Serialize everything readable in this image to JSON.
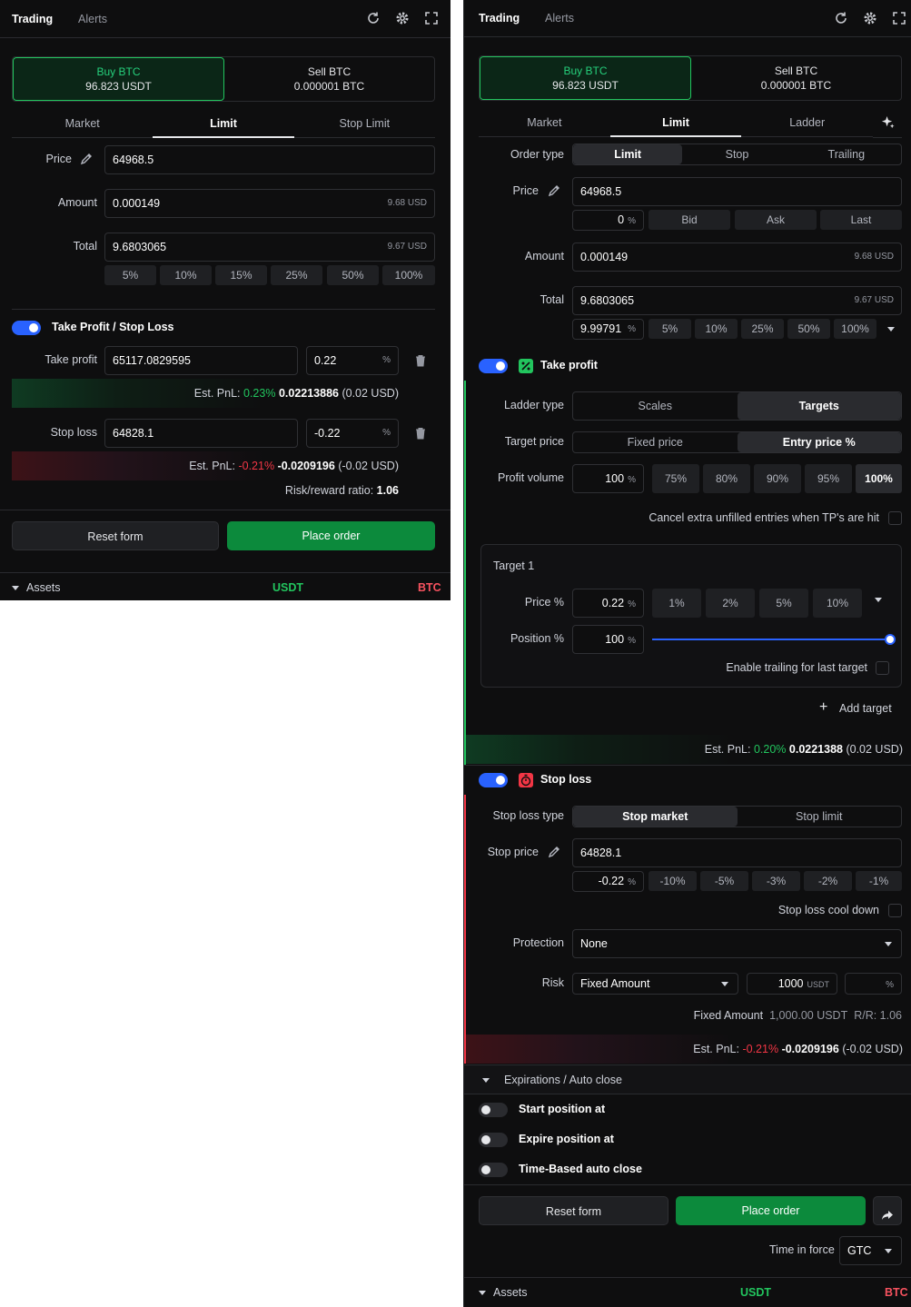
{
  "left": {
    "tabs": {
      "trading": "Trading",
      "alerts": "Alerts"
    },
    "buy": {
      "label": "Buy BTC",
      "value": "96.823 USDT"
    },
    "sell": {
      "label": "Sell BTC",
      "value": "0.000001 BTC"
    },
    "mode_tabs": [
      "Market",
      "Limit",
      "Stop Limit"
    ],
    "price": {
      "label": "Price",
      "value": "64968.5"
    },
    "amount": {
      "label": "Amount",
      "value": "0.000149",
      "suffix": "9.68 USD"
    },
    "total": {
      "label": "Total",
      "value": "9.6803065",
      "suffix": "9.67 USD"
    },
    "percent_chips": [
      "5%",
      "10%",
      "15%",
      "25%",
      "50%",
      "100%"
    ],
    "tpsl_label": "Take Profit / Stop Loss",
    "take_profit": {
      "label": "Take profit",
      "value": "65117.0829595",
      "pct": "0.22",
      "pct_unit": "%"
    },
    "tp_pnl": {
      "label": "Est. PnL:",
      "pct": "0.23%",
      "value": "0.02213886",
      "usd": "(0.02 USD)"
    },
    "stop_loss": {
      "label": "Stop loss",
      "value": "64828.1",
      "pct": "-0.22",
      "pct_unit": "%"
    },
    "sl_pnl": {
      "label": "Est. PnL:",
      "pct": "-0.21%",
      "value": "-0.0209196",
      "usd": "(-0.02 USD)"
    },
    "rr": {
      "label": "Risk/reward ratio:",
      "value": "1.06"
    },
    "reset": "Reset form",
    "place": "Place order",
    "assets": {
      "label": "Assets",
      "usdt": "USDT",
      "btc": "BTC"
    }
  },
  "right": {
    "tabs": {
      "trading": "Trading",
      "alerts": "Alerts"
    },
    "buy": {
      "label": "Buy BTC",
      "value": "96.823 USDT"
    },
    "sell": {
      "label": "Sell BTC",
      "value": "0.000001 BTC"
    },
    "mode_tabs": [
      "Market",
      "Limit",
      "Ladder"
    ],
    "order_type": {
      "label": "Order type",
      "options": [
        "Limit",
        "Stop",
        "Trailing"
      ]
    },
    "price": {
      "label": "Price",
      "value": "64968.5",
      "offset": "0",
      "offset_unit": "%",
      "quick": [
        "Bid",
        "Ask",
        "Last"
      ]
    },
    "amount": {
      "label": "Amount",
      "value": "0.000149",
      "suffix": "9.68 USD"
    },
    "total": {
      "label": "Total",
      "value": "9.6803065",
      "suffix": "9.67 USD",
      "pct": "9.99791",
      "pct_unit": "%",
      "chips": [
        "5%",
        "10%",
        "25%",
        "50%",
        "100%"
      ]
    },
    "take_profit": {
      "label": "Take profit",
      "ladder_type": {
        "label": "Ladder type",
        "options": [
          "Scales",
          "Targets"
        ]
      },
      "target_price": {
        "label": "Target price",
        "options": [
          "Fixed price",
          "Entry price %"
        ]
      },
      "profit_volume": {
        "label": "Profit volume",
        "value": "100",
        "unit": "%",
        "chips": [
          "75%",
          "80%",
          "90%",
          "95%",
          "100%"
        ]
      },
      "cancel_label": "Cancel extra unfilled entries when TP's are hit",
      "target": {
        "title": "Target 1",
        "price_label": "Price %",
        "price_value": "0.22",
        "price_unit": "%",
        "chips": [
          "1%",
          "2%",
          "5%",
          "10%"
        ],
        "position_label": "Position %",
        "position_value": "100",
        "position_unit": "%",
        "position_level": 1.0,
        "trailing_label": "Enable trailing for last target"
      },
      "add_target": "Add target",
      "pnl": {
        "label": "Est. PnL:",
        "pct": "0.20%",
        "value": "0.0221388",
        "usd": "(0.02 USD)"
      }
    },
    "stop_loss": {
      "label": "Stop loss",
      "type": {
        "label": "Stop loss type",
        "options": [
          "Stop market",
          "Stop limit"
        ]
      },
      "price": {
        "label": "Stop price",
        "value": "64828.1",
        "offset": "-0.22",
        "offset_unit": "%",
        "chips": [
          "-10%",
          "-5%",
          "-3%",
          "-2%",
          "-1%"
        ]
      },
      "cooldown_label": "Stop loss cool down",
      "protection": {
        "label": "Protection",
        "value": "None"
      },
      "risk": {
        "label": "Risk",
        "mode": "Fixed Amount",
        "amount": "1000",
        "amount_unit": "USDT",
        "pct_unit": "%"
      },
      "summary": {
        "label": "Fixed Amount",
        "value": "1,000.00 USDT",
        "rr": "R/R: 1.06"
      },
      "pnl": {
        "label": "Est. PnL:",
        "pct": "-0.21%",
        "value": "-0.0209196",
        "usd": "(-0.02 USD)"
      }
    },
    "expirations": {
      "label": "Expirations / Auto close",
      "items": [
        "Start position at",
        "Expire position at",
        "Time-Based auto close"
      ]
    },
    "reset": "Reset form",
    "place": "Place order",
    "tif": {
      "label": "Time in force",
      "value": "GTC"
    },
    "assets": {
      "label": "Assets",
      "usdt": "USDT",
      "btc": "BTC"
    }
  }
}
